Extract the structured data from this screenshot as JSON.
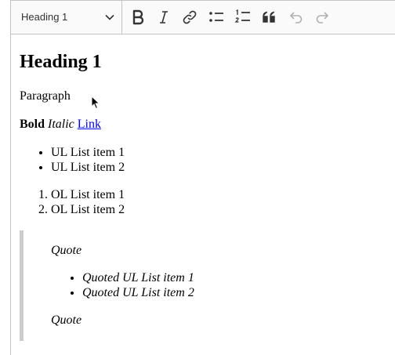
{
  "toolbar": {
    "heading_select": "Heading 1",
    "buttons": [
      {
        "name": "bold",
        "icon": "bold-icon"
      },
      {
        "name": "italic",
        "icon": "italic-icon"
      },
      {
        "name": "link",
        "icon": "link-icon"
      },
      {
        "name": "bulleted-list",
        "icon": "bulleted-list-icon"
      },
      {
        "name": "numbered-list",
        "icon": "numbered-list-icon"
      },
      {
        "name": "block-quote",
        "icon": "quote-icon"
      },
      {
        "name": "undo",
        "icon": "undo-icon",
        "disabled": true
      },
      {
        "name": "redo",
        "icon": "redo-icon",
        "disabled": true
      }
    ]
  },
  "content": {
    "heading": "Heading 1",
    "paragraph": "Paragraph",
    "bold": "Bold",
    "italic": "Italic",
    "link": "Link",
    "ul_items": [
      "UL List item 1",
      "UL List item 2"
    ],
    "ol_items": [
      "OL List item 1",
      "OL List item 2"
    ],
    "quote": {
      "top": "Quote",
      "items": [
        "Quoted UL List item 1",
        "Quoted UL List item 2"
      ],
      "bottom": "Quote"
    }
  },
  "colors": {
    "toolbar_bg": "#fafafa",
    "border": "#c4c4c4",
    "icon": "#333333",
    "icon_disabled": "#b0b0b0",
    "link": "#0000ee",
    "quote_border": "#cccccc"
  }
}
